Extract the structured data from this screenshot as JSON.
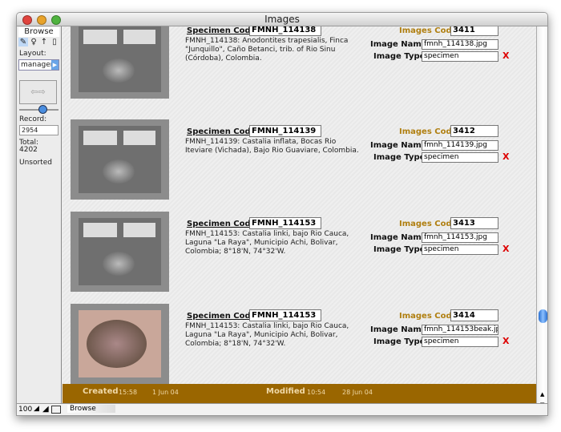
{
  "window": {
    "title": "Images"
  },
  "sidebar": {
    "mode": "Browse",
    "layout_label": "Layout:",
    "layout_value": "managem",
    "record_label": "Record:",
    "record_value": "2954",
    "total_label": "Total:",
    "total_value": "4202",
    "sort_status": "Unsorted"
  },
  "labels": {
    "specimen_code": "Specimen Code",
    "images_code": "Images Code",
    "image_name": "Image Name",
    "image_type": "Image Type",
    "delete": "X"
  },
  "records": [
    {
      "specimen_code": "FMNH_114138",
      "description": "FMNH_114138: Anodontites trapesialis, Finca \"Junquillo\", Caño Betanci, trib. of Rio Sinu (Córdoba), Colombia.",
      "images_code": "3411",
      "image_name": "fmnh_114138.jpg",
      "image_type": "specimen"
    },
    {
      "specimen_code": "FMNH_114139",
      "description": "FMNH_114139: Castalia inflata, Bocas Rio Iteviare (Vichada), Bajo Rio Guaviare, Colombia.",
      "images_code": "3412",
      "image_name": "fmnh_114139.jpg",
      "image_type": "specimen"
    },
    {
      "specimen_code": "FMNH_114153",
      "description": "FMNH_114153: Castalia linki, bajo Rio Cauca, Laguna \"La Raya\", Municipio Achi, Bolivar, Colombia; 8°18'N, 74°32'W.",
      "images_code": "3413",
      "image_name": "fmnh_114153.jpg",
      "image_type": "specimen"
    },
    {
      "specimen_code": "FMNH_114153",
      "description": "FMNH_114153: Castalia linki, bajo Rio Cauca, Laguna \"La Raya\", Municipio Achi, Bolivar, Colombia; 8°18'N, 74°32'W.",
      "images_code": "3414",
      "image_name": "fmnh_114153beak.jpg",
      "image_type": "specimen"
    }
  ],
  "footer": {
    "created_label": "Created",
    "created_time": "15:58",
    "created_date": "1 Jun 04",
    "modified_label": "Modified",
    "modified_time": "10:54",
    "modified_date": "28 Jun 04"
  },
  "status": {
    "zoom": "100",
    "mode": "Browse"
  },
  "colors": {
    "accent": "#9a6600",
    "images_code_label": "#b07f10",
    "delete": "#dd0000"
  }
}
